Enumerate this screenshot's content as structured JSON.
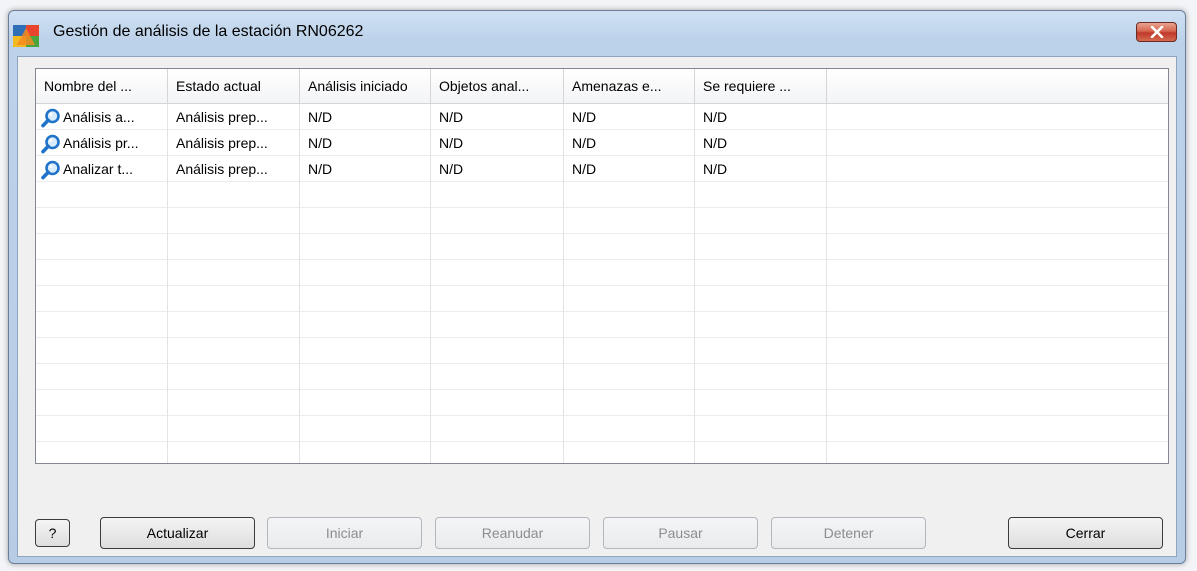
{
  "window": {
    "title": "Gestión de análisis de la estación RN06262",
    "accent": "#c0392b"
  },
  "listview": {
    "columns": [
      "Nombre del ...",
      "Estado actual",
      "Análisis iniciado",
      "Objetos anal...",
      "Amenazas e...",
      "Se requiere ..."
    ],
    "rows": [
      {
        "icon": "magnifier-icon",
        "cells": [
          "Análisis a...",
          "Análisis prep...",
          "N/D",
          "N/D",
          "N/D",
          "N/D"
        ]
      },
      {
        "icon": "magnifier-icon",
        "cells": [
          "Análisis pr...",
          "Análisis prep...",
          "N/D",
          "N/D",
          "N/D",
          "N/D"
        ]
      },
      {
        "icon": "magnifier-icon",
        "cells": [
          "Analizar t...",
          "Análisis prep...",
          "N/D",
          "N/D",
          "N/D",
          "N/D"
        ]
      }
    ]
  },
  "buttons": {
    "help": "?",
    "refresh": "Actualizar",
    "start": "Iniciar",
    "resume": "Reanudar",
    "pause": "Pausar",
    "stop": "Detener",
    "close": "Cerrar"
  }
}
